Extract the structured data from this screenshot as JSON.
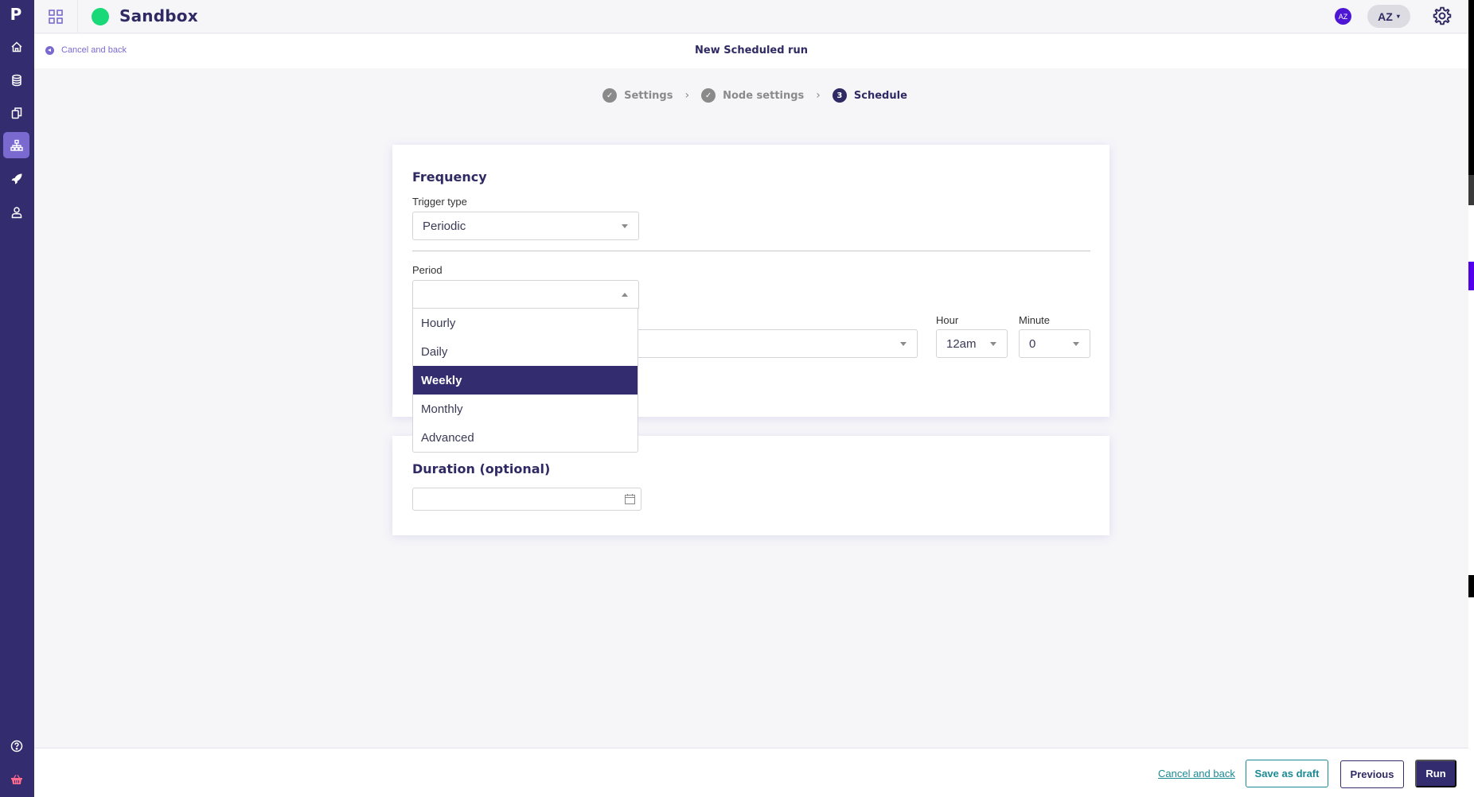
{
  "sidebar": {
    "logo": "P",
    "items": [
      {
        "name": "home",
        "icon": "home-icon"
      },
      {
        "name": "data",
        "icon": "database-icon"
      },
      {
        "name": "documents",
        "icon": "copy-icon"
      },
      {
        "name": "pipelines",
        "icon": "sitemap-icon",
        "active": true
      },
      {
        "name": "deployments",
        "icon": "rocket-icon"
      },
      {
        "name": "users",
        "icon": "user-icon"
      }
    ],
    "bottom": [
      {
        "name": "help",
        "icon": "help-icon"
      },
      {
        "name": "marketplace",
        "icon": "basket-icon"
      }
    ]
  },
  "topbar": {
    "environment": "Sandbox",
    "environment_color": "#18d877",
    "avatar_initials": "AZ",
    "user_menu_label": "AZ",
    "user_menu_caret": "▾"
  },
  "subheader": {
    "cancel_label": "Cancel and back",
    "title": "New Scheduled run"
  },
  "stepper": {
    "steps": [
      {
        "label": "Settings",
        "status": "done",
        "badge": "✓"
      },
      {
        "label": "Node settings",
        "status": "done",
        "badge": "✓"
      },
      {
        "label": "Schedule",
        "status": "current",
        "badge": "3"
      }
    ],
    "separator": "›"
  },
  "frequency": {
    "title": "Frequency",
    "trigger_type_label": "Trigger type",
    "trigger_type_value": "Periodic",
    "period_label": "Period",
    "period_value": "",
    "period_options": [
      "Hourly",
      "Daily",
      "Weekly",
      "Monthly",
      "Advanced"
    ],
    "period_highlighted": "Weekly",
    "day_value": "",
    "hour_label": "Hour",
    "hour_value": "12am",
    "minute_label": "Minute",
    "minute_value": "0"
  },
  "duration": {
    "title": "Duration (optional)",
    "value": ""
  },
  "footer": {
    "cancel_label": "Cancel and back",
    "save_draft_label": "Save as draft",
    "previous_label": "Previous",
    "run_label": "Run"
  },
  "colors": {
    "brand": "#332d6f",
    "accent": "#7a6ad0",
    "teal": "#1b8a94",
    "success": "#18d877"
  }
}
